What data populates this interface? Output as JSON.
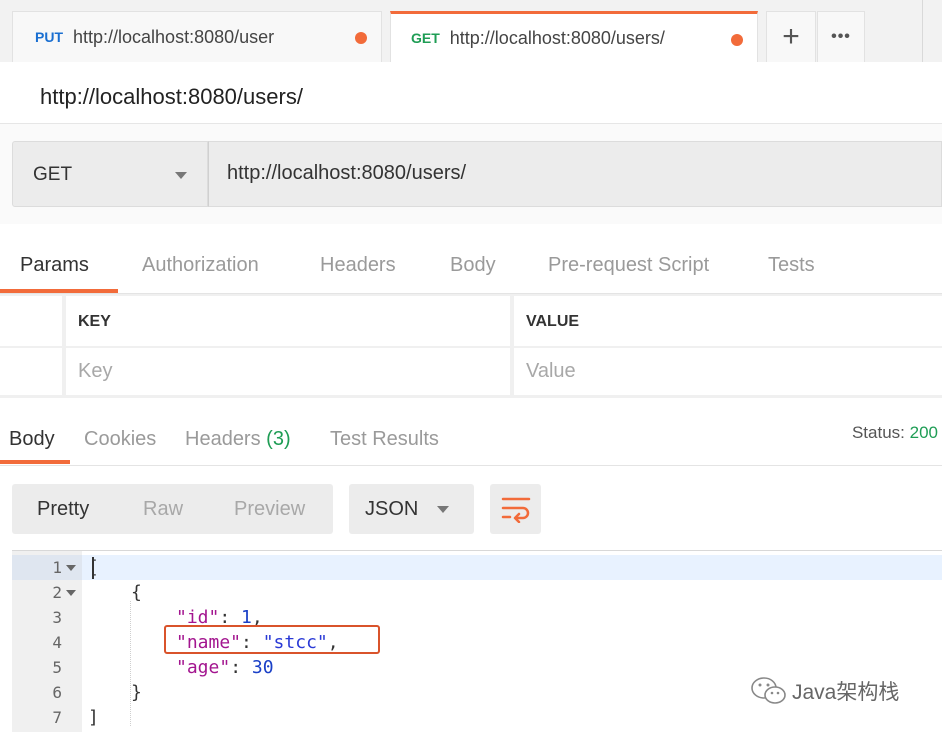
{
  "tabs": [
    {
      "method": "PUT",
      "url": "http://localhost:8080/user",
      "method_color": "#1a6fd1"
    },
    {
      "method": "GET",
      "url": "http://localhost:8080/users/",
      "method_color": "#1f9d55",
      "active": true
    }
  ],
  "tab_actions": {
    "new_tab_symbol": "+",
    "more_symbol": "•••"
  },
  "request": {
    "name": "http://localhost:8080/users/",
    "method": "GET",
    "url": "http://localhost:8080/users/"
  },
  "request_tabs": [
    "Params",
    "Authorization",
    "Headers",
    "Body",
    "Pre-request Script",
    "Tests"
  ],
  "params_table": {
    "columns": [
      "KEY",
      "VALUE"
    ],
    "placeholders": [
      "Key",
      "Value"
    ]
  },
  "response_tabs": {
    "body": "Body",
    "cookies": "Cookies",
    "headers": "Headers",
    "headers_count": "(3)",
    "test_results": "Test Results"
  },
  "status": {
    "label": "Status:",
    "code": "200"
  },
  "body_view": {
    "modes": [
      "Pretty",
      "Raw",
      "Preview"
    ],
    "format": "JSON",
    "wrap_icon": "wrap-lines-icon"
  },
  "response_code": {
    "line_numbers": [
      "1",
      "2",
      "3",
      "4",
      "5",
      "6",
      "7"
    ],
    "open_bracket": "[",
    "open_brace": "{",
    "fields": [
      {
        "key": "\"id\"",
        "value": "1",
        "sep": ": ",
        "trail": ","
      },
      {
        "key": "\"name\"",
        "value": "\"stcc\"",
        "sep": ": ",
        "trail": ","
      },
      {
        "key": "\"age\"",
        "value": "30",
        "sep": ": ",
        "trail": ""
      }
    ],
    "close_brace": "}",
    "close_bracket": "]"
  },
  "colors": {
    "accent": "#f26b3a",
    "success": "#1f9d55",
    "json_key": "#a3158f",
    "json_value": "#2a3ad6"
  },
  "watermark": {
    "text": "Java架构栈"
  }
}
